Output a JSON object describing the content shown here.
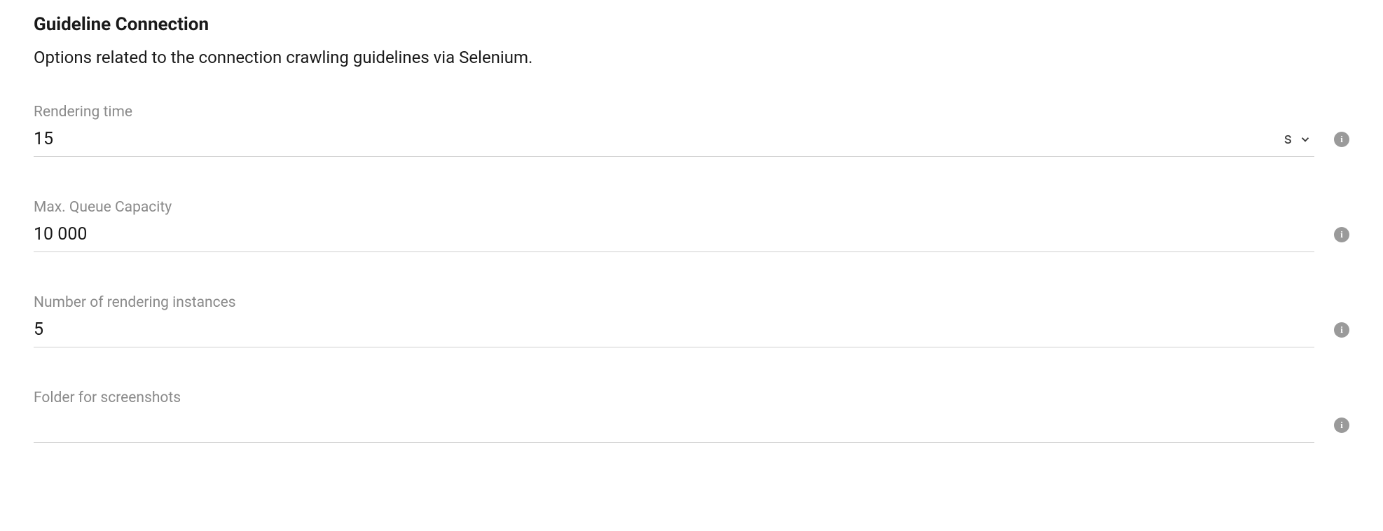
{
  "section": {
    "title": "Guideline Connection",
    "description": "Options related to the connection crawling guidelines via Selenium."
  },
  "fields": {
    "renderingTime": {
      "label": "Rendering time",
      "value": "15",
      "unit": "s"
    },
    "maxQueue": {
      "label": "Max. Queue Capacity",
      "value": "10 000"
    },
    "instances": {
      "label": "Number of rendering instances",
      "value": "5"
    },
    "screenshotFolder": {
      "label": "Folder for screenshots",
      "value": ""
    }
  },
  "icons": {
    "info": "i"
  }
}
